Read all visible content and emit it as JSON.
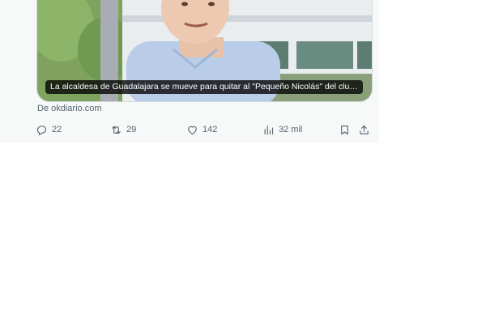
{
  "tweet": {
    "media": {
      "caption": "La alcaldesa de Guadalajara se mueve para quitar al \"Pequeño Nicolás\" del clu…"
    },
    "source": "De okdiario.com",
    "actions": {
      "reply": {
        "icon": "reply-icon",
        "count": "22"
      },
      "retweet": {
        "icon": "retweet-icon",
        "count": "29"
      },
      "like": {
        "icon": "like-icon",
        "count": "142"
      },
      "views": {
        "icon": "views-icon",
        "count": "32 mil"
      },
      "bookmark": {
        "icon": "bookmark-icon"
      },
      "share": {
        "icon": "share-icon"
      }
    }
  },
  "colors": {
    "background": "#f7f9f9",
    "muted_text": "#536471",
    "caption_bg": "#000000"
  }
}
